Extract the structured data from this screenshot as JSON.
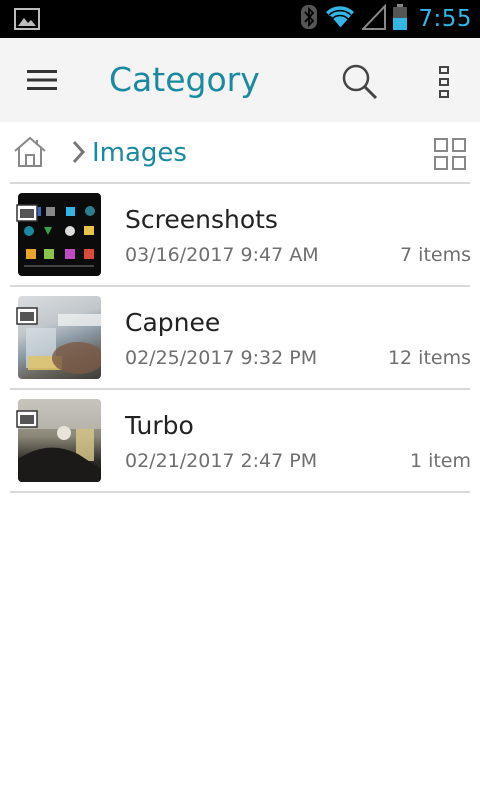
{
  "status_bar": {
    "time": "7:55",
    "icons": [
      "image-notification-icon",
      "bluetooth-icon",
      "wifi-icon",
      "signal-icon",
      "battery-icon"
    ],
    "time_color": "#33b5e5"
  },
  "app_bar": {
    "title": "Category",
    "accent_color": "#1a8aa0",
    "icons": [
      "menu-icon",
      "search-icon",
      "more-vert-icon"
    ]
  },
  "breadcrumb": {
    "home_icon": "home-icon",
    "current": "Images",
    "view_toggle_icon": "grid-view-icon"
  },
  "folders": [
    {
      "name": "Screenshots",
      "date": "03/16/2017 9:47 AM",
      "count": "7 items"
    },
    {
      "name": "Capnee",
      "date": "02/25/2017 9:32 PM",
      "count": "12 items"
    },
    {
      "name": "Turbo",
      "date": "02/21/2017 2:47 PM",
      "count": "1 item"
    }
  ]
}
